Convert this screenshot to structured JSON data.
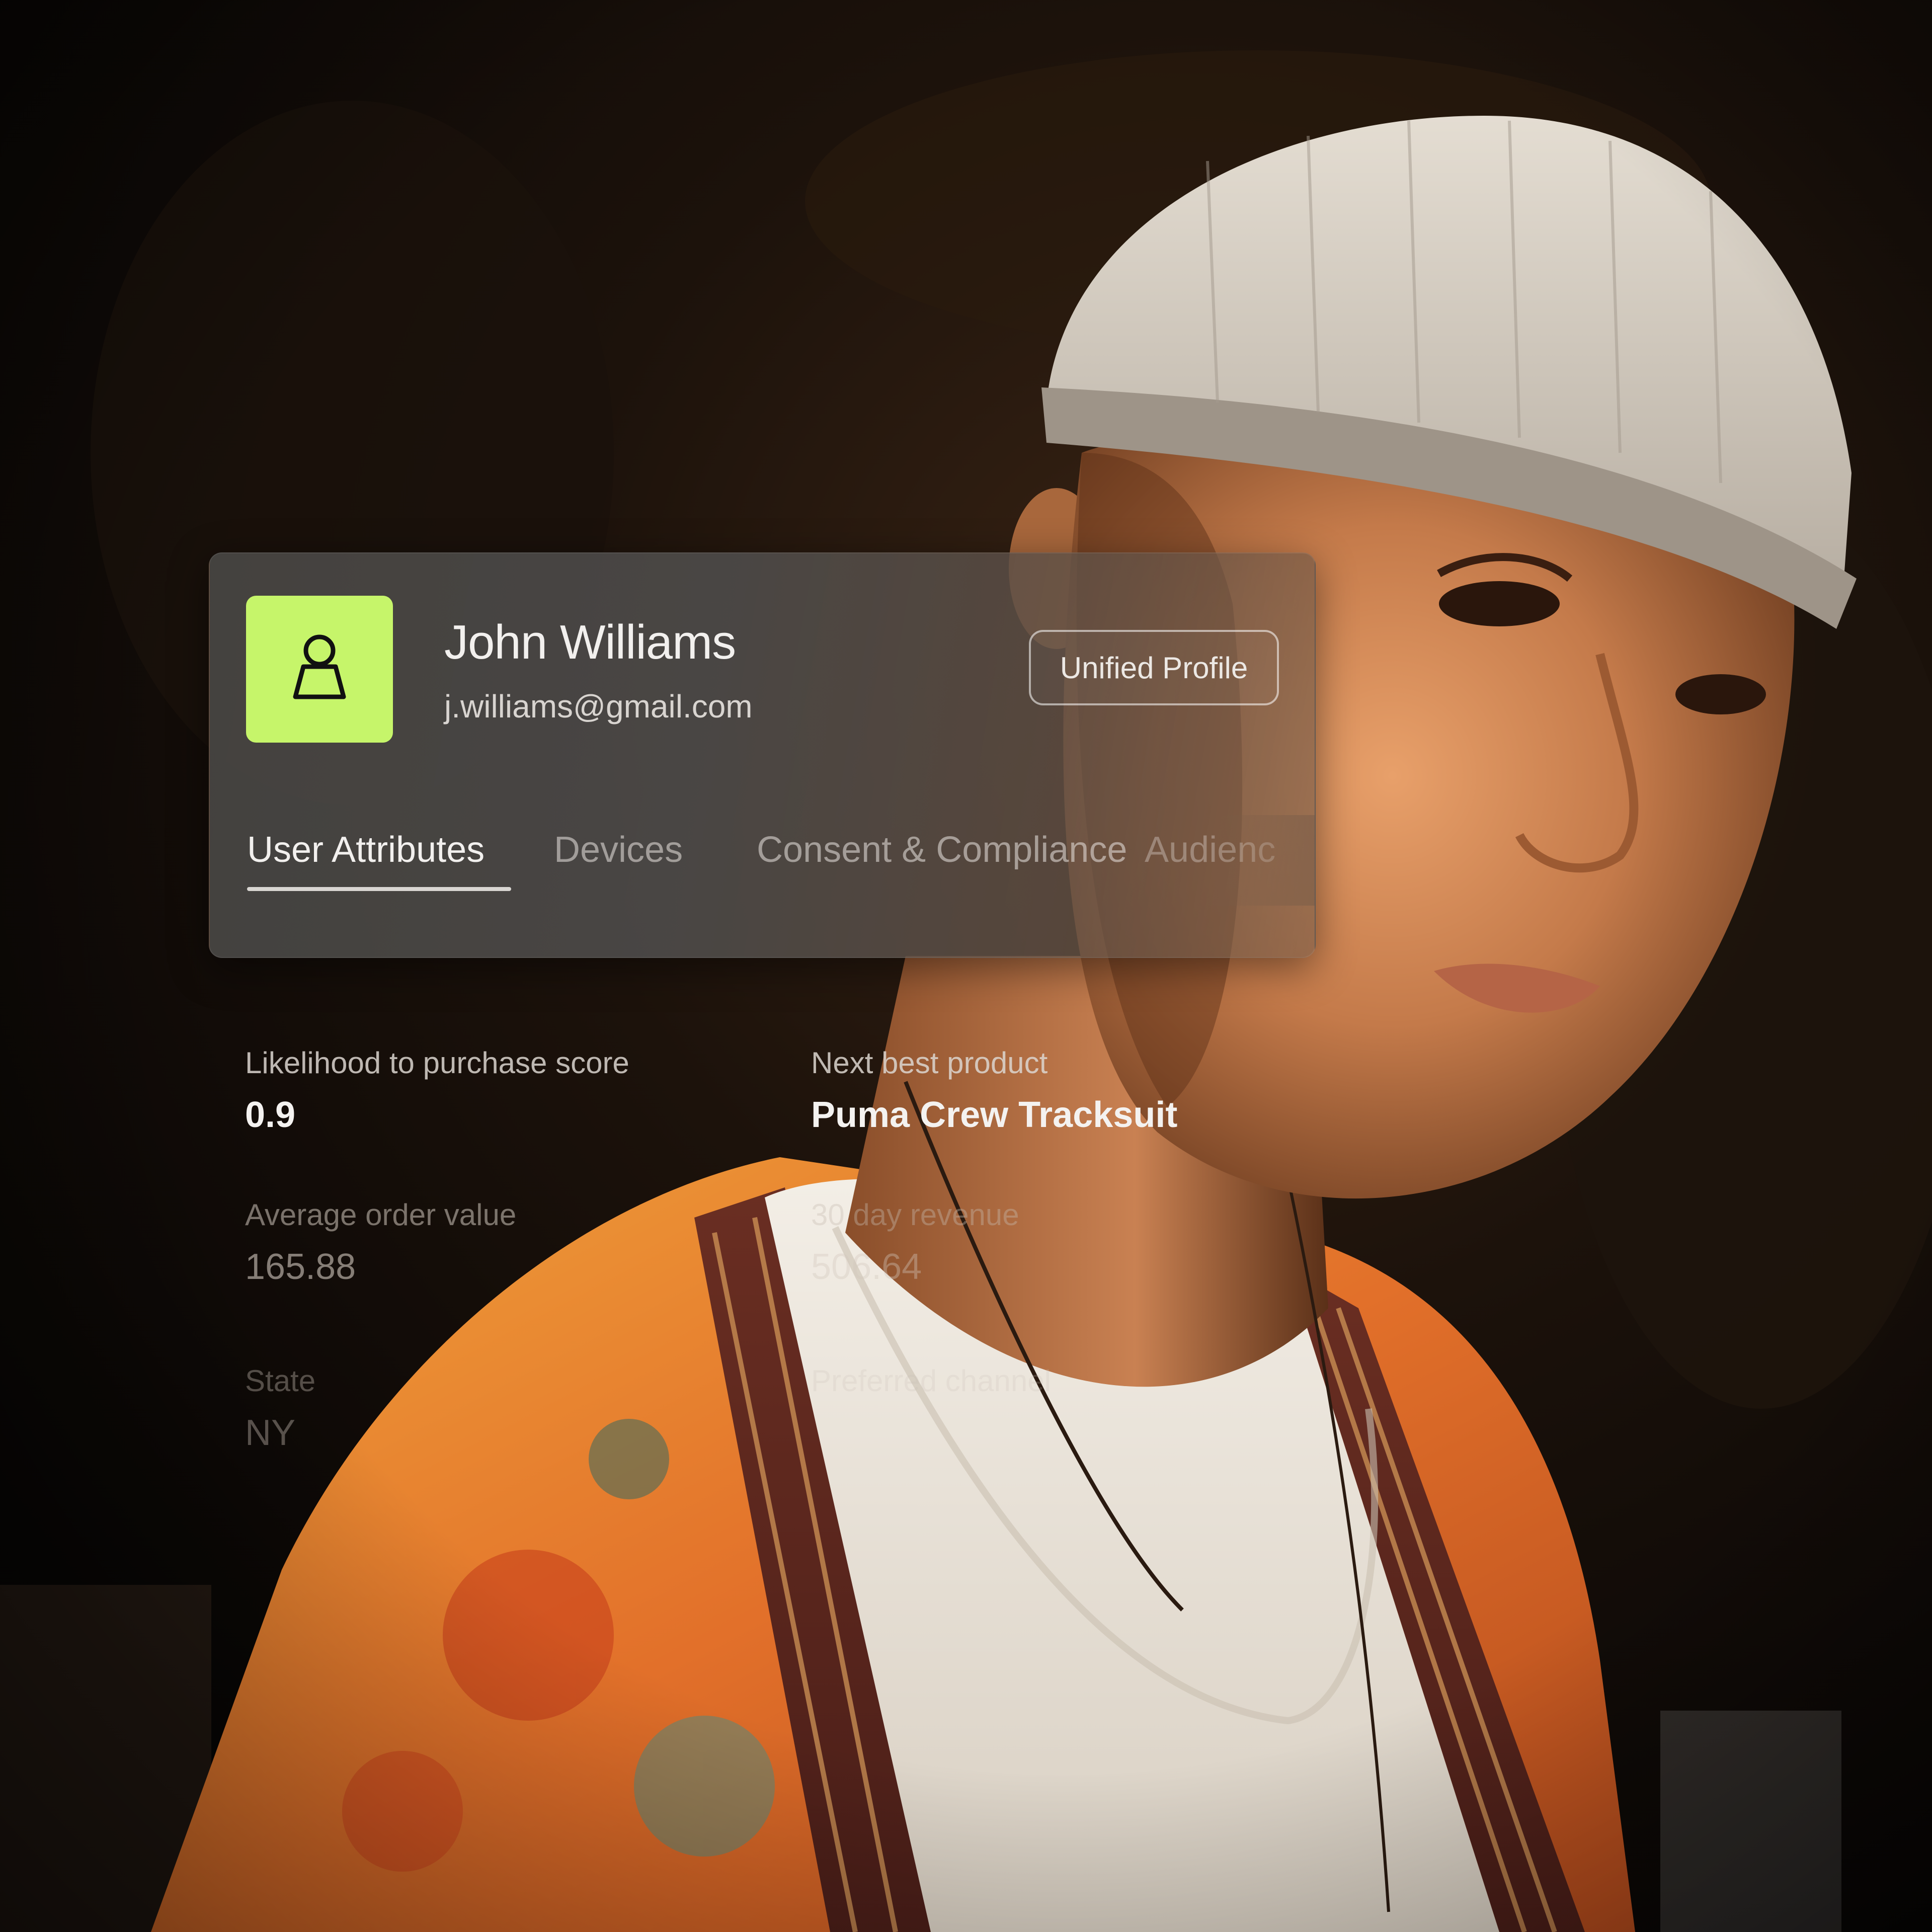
{
  "profile": {
    "name": "John Williams",
    "email": "j.williams@gmail.com",
    "badge": "Unified Profile",
    "avatar_icon": "user-icon",
    "accent_color": "#c6f56a"
  },
  "tabs": [
    {
      "label": "User Attributes",
      "active": true
    },
    {
      "label": "Devices",
      "active": false
    },
    {
      "label": "Consent & Compliance",
      "active": false
    },
    {
      "label": "Audienc",
      "active": false
    }
  ],
  "attributes": {
    "likelihood": {
      "label": "Likelihood to purchase score",
      "value": "0.9"
    },
    "next_product": {
      "label": "Next best product",
      "value": "Puma Crew Tracksuit"
    },
    "aov": {
      "label": "Average order value",
      "value": "165.88"
    },
    "revenue_30": {
      "label": "30 day revenue",
      "value": "506.64"
    },
    "state": {
      "label": "State",
      "value": "NY"
    },
    "preferred_channel": {
      "label": "Preferred channel"
    }
  }
}
